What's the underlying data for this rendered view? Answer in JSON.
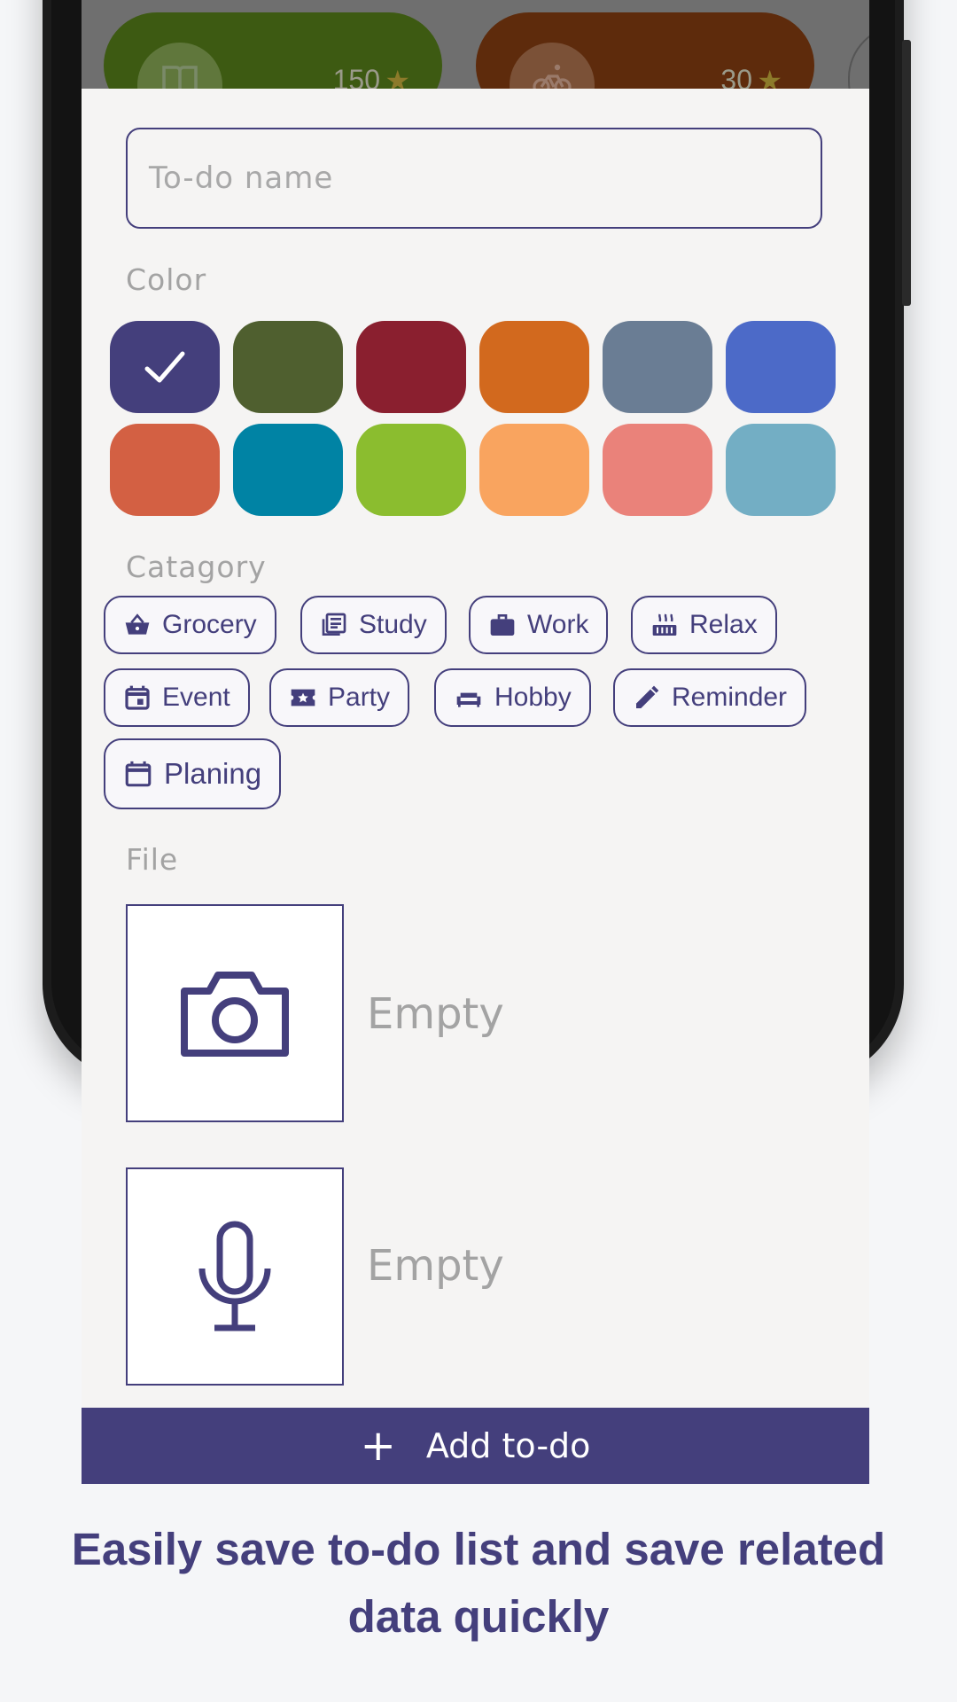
{
  "background_cards": [
    {
      "points": "150",
      "color": "#3d5a12",
      "icon": "book-icon"
    },
    {
      "points": "30",
      "color": "#5e2b0c",
      "icon": "bicycle-icon"
    }
  ],
  "form": {
    "name_placeholder": "To-do name",
    "color_label": "Color",
    "colors": [
      "#443f7c",
      "#4f5f2f",
      "#8a1f2f",
      "#d2691e",
      "#6a7d94",
      "#4c6ac8",
      "#d36043",
      "#0083a4",
      "#8bbd2f",
      "#f9a45f",
      "#ea827a",
      "#73aec4"
    ],
    "selected_color_index": 0,
    "category_label": "Catagory",
    "categories": [
      {
        "label": "Grocery",
        "icon": "basket-icon"
      },
      {
        "label": "Study",
        "icon": "newspaper-icon"
      },
      {
        "label": "Work",
        "icon": "briefcase-icon"
      },
      {
        "label": "Relax",
        "icon": "hot-tub-icon"
      },
      {
        "label": "Event",
        "icon": "calendar-event-icon"
      },
      {
        "label": "Party",
        "icon": "ticket-icon"
      },
      {
        "label": "Hobby",
        "icon": "couch-icon"
      },
      {
        "label": "Reminder",
        "icon": "pencil-icon"
      },
      {
        "label": "Planing",
        "icon": "calendar-icon"
      }
    ],
    "file_label": "File",
    "photo_status": "Empty",
    "audio_status": "Empty",
    "add_button_label": "Add to-do"
  },
  "tagline": {
    "line1": "Easily save to-do list and save related",
    "line2": "data quickly"
  }
}
